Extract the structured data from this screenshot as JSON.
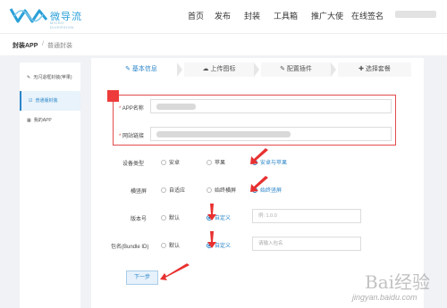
{
  "header": {
    "brand": "微导流",
    "brand_sub": "MICRO DIVERSION",
    "nav": [
      "首页",
      "发布",
      "封装",
      "工具箱",
      "推广大使",
      "在线签名"
    ]
  },
  "breadcrumb": {
    "parent": "封装APP",
    "separator": "/",
    "current": "普通封装"
  },
  "sidebar": {
    "items": [
      {
        "icon": "edit-icon",
        "label": "无闪退框封装(苹果)"
      },
      {
        "icon": "package-icon",
        "label": "普通版封装"
      },
      {
        "icon": "grid-icon",
        "label": "我的APP"
      }
    ]
  },
  "steps": [
    {
      "icon": "edit-icon",
      "label": "基本信息"
    },
    {
      "icon": "cloud-upload-icon",
      "label": "上传图标"
    },
    {
      "icon": "edit-icon",
      "label": "配置插件"
    },
    {
      "icon": "plus-icon",
      "label": "选择套餐"
    }
  ],
  "form": {
    "app_name_label": "APP名称",
    "url_label": "网站链接",
    "required_mark": "*",
    "device_type": {
      "label": "设备类型",
      "options": [
        "安卓",
        "苹果",
        "安卓与苹果"
      ],
      "selected": "安卓与苹果"
    },
    "landscape": {
      "label": "横竖屏",
      "options": [
        "自适应",
        "始终横屏",
        "始终竖屏"
      ],
      "selected": "始终竖屏"
    },
    "version": {
      "label": "版本号",
      "options": [
        "默认",
        "自定义"
      ],
      "selected": "自定义",
      "placeholder": "例: 1.0.0"
    },
    "bundle_id": {
      "label": "包名(Bundle ID)",
      "options": [
        "默认",
        "自定义"
      ],
      "selected": "自定义",
      "placeholder": "请输入包名"
    },
    "next_button": "下一步"
  },
  "watermark": {
    "text": "Bai经验",
    "url": "jingyan.baidu.com"
  },
  "colors": {
    "accent": "#2b86c9",
    "annotation_red": "#e24b4b"
  }
}
